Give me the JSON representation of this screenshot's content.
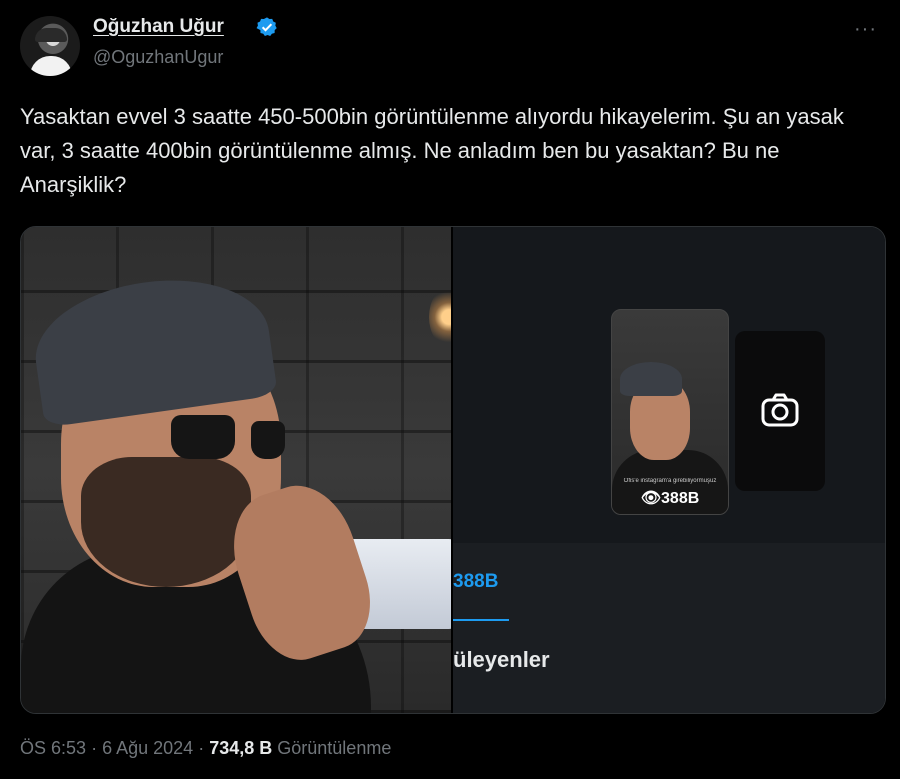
{
  "author": {
    "name": "Oğuzhan Uğur",
    "handle": "@OguzhanUgur",
    "verified": true
  },
  "icons": {
    "more": "more-icon",
    "verified": "verified-badge-icon",
    "camera": "camera-icon",
    "eye": "eye-icon"
  },
  "colors": {
    "background": "#000000",
    "accent": "#1d9bf0",
    "text": "#e7e9ea",
    "muted": "#71767b"
  },
  "tweet": {
    "text": "Yasaktan evvel 3 saatte 450-500bin görüntülenme alıyordu hikayelerim. Şu an yasak var, 3 saatte 400bin görüntülenme almış. Ne anladım ben bu yasaktan? Bu ne Anarşiklik?"
  },
  "media": {
    "thumb_caption": "Ofis'e instagram'a girebiliyormuşuz",
    "thumb_views": "388B",
    "views_count": "388B",
    "viewers_label": "üleyenler"
  },
  "meta": {
    "time": "ÖS 6:53",
    "dot": "·",
    "date": "6 Ağu 2024",
    "views_number": "734,8 B",
    "views_label": "Görüntülenme"
  }
}
